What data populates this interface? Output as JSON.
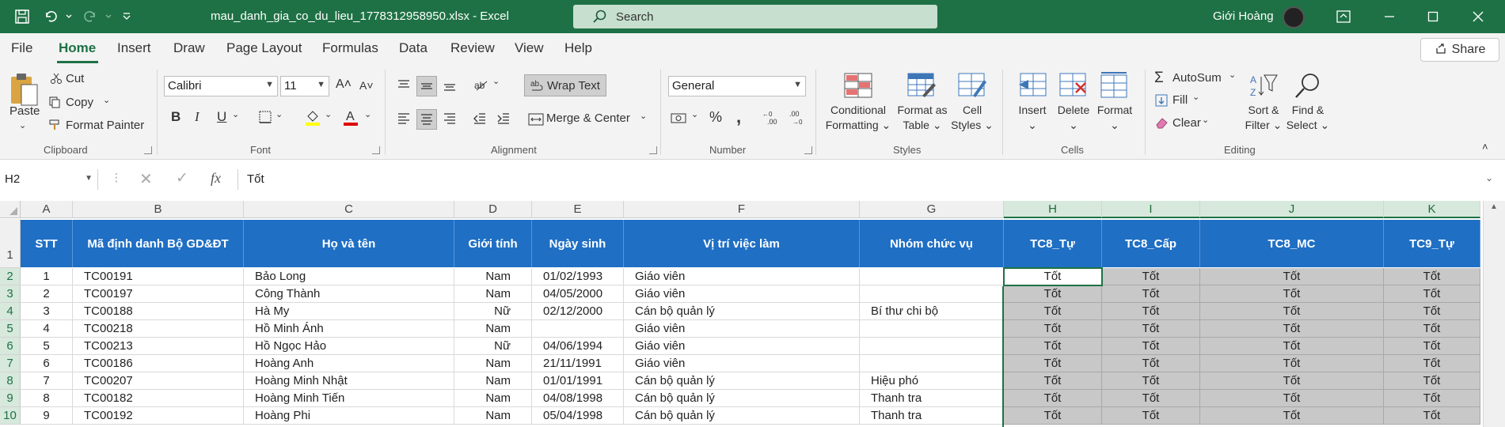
{
  "app": {
    "doc_title": "mau_danh_gia_co_du_lieu_1778312958950.xlsx  -  Excel",
    "search_placeholder": "Search",
    "user_name": "Giới Hoàng",
    "share_label": "Share"
  },
  "menu": {
    "tabs": [
      "File",
      "Home",
      "Insert",
      "Draw",
      "Page Layout",
      "Formulas",
      "Data",
      "Review",
      "View",
      "Help"
    ],
    "active": "Home"
  },
  "ribbon": {
    "clipboard": {
      "paste": "Paste",
      "cut": "Cut",
      "copy": "Copy",
      "format_painter": "Format Painter",
      "label": "Clipboard"
    },
    "font": {
      "name": "Calibri",
      "size": "11",
      "bold": "B",
      "italic": "I",
      "underline": "U",
      "label": "Font"
    },
    "alignment": {
      "wrap": "Wrap Text",
      "merge": "Merge & Center",
      "label": "Alignment"
    },
    "number": {
      "format": "General",
      "label": "Number"
    },
    "styles": {
      "conditional": "Conditional",
      "conditional2": "Formatting",
      "format_as": "Format as",
      "table": "Table",
      "cell": "Cell",
      "cell2": "Styles",
      "label": "Styles"
    },
    "cells": {
      "insert": "Insert",
      "delete": "Delete",
      "format": "Format",
      "label": "Cells"
    },
    "editing": {
      "autosum": "AutoSum",
      "fill": "Fill",
      "clear": "Clear",
      "sort": "Sort &",
      "filter": "Filter",
      "find": "Find &",
      "select": "Select",
      "label": "Editing"
    }
  },
  "formula_bar": {
    "name_box": "H2",
    "content": "Tốt"
  },
  "sheet": {
    "columns": [
      "A",
      "B",
      "C",
      "D",
      "E",
      "F",
      "G",
      "H",
      "I",
      "J",
      "K"
    ],
    "headers": [
      "STT",
      "Mã định danh Bộ GD&ĐT",
      "Họ và tên",
      "Giới tính",
      "Ngày sinh",
      "Vị trí việc làm",
      "Nhóm chức vụ",
      "TC8_Tự",
      "TC8_Cấp",
      "TC8_MC",
      "TC9_Tự"
    ],
    "row_numbers": [
      "1",
      "2",
      "3",
      "4",
      "5",
      "6",
      "7",
      "8",
      "9",
      "10"
    ],
    "rows": [
      [
        "1",
        "TC00191",
        "Bảo Long",
        "Nam",
        "01/02/1993",
        "Giáo viên",
        "",
        "Tốt",
        "Tốt",
        "Tốt",
        "Tốt"
      ],
      [
        "2",
        "TC00197",
        "Công Thành",
        "Nam",
        "04/05/2000",
        "Giáo viên",
        "",
        "Tốt",
        "Tốt",
        "Tốt",
        "Tốt"
      ],
      [
        "3",
        "TC00188",
        "Hà My",
        "Nữ",
        "02/12/2000",
        "Cán bộ quản lý",
        "Bí thư chi bộ",
        "Tốt",
        "Tốt",
        "Tốt",
        "Tốt"
      ],
      [
        "4",
        "TC00218",
        "Hồ Minh Ánh",
        "Nam",
        "",
        "Giáo viên",
        "",
        "Tốt",
        "Tốt",
        "Tốt",
        "Tốt"
      ],
      [
        "5",
        "TC00213",
        "Hồ Ngọc Hảo",
        "Nữ",
        "04/06/1994",
        "Giáo viên",
        "",
        "Tốt",
        "Tốt",
        "Tốt",
        "Tốt"
      ],
      [
        "6",
        "TC00186",
        "Hoàng Anh",
        "Nam",
        "21/11/1991",
        "Giáo viên",
        "",
        "Tốt",
        "Tốt",
        "Tốt",
        "Tốt"
      ],
      [
        "7",
        "TC00207",
        "Hoàng Minh Nhật",
        "Nam",
        "01/01/1991",
        "Cán bộ quản lý",
        "Hiệu phó",
        "Tốt",
        "Tốt",
        "Tốt",
        "Tốt"
      ],
      [
        "8",
        "TC00182",
        "Hoàng Minh Tiến",
        "Nam",
        "04/08/1998",
        "Cán bộ quản lý",
        "Thanh tra",
        "Tốt",
        "Tốt",
        "Tốt",
        "Tốt"
      ],
      [
        "9",
        "TC00192",
        "Hoàng Phi",
        "Nam",
        "05/04/1998",
        "Cán bộ quản lý",
        "Thanh tra",
        "Tốt",
        "Tốt",
        "Tốt",
        "Tốt"
      ]
    ]
  },
  "colors": {
    "excel_green": "#1e7145",
    "header_blue": "#1f6fc4",
    "gray_fill": "#c8c8c8"
  }
}
